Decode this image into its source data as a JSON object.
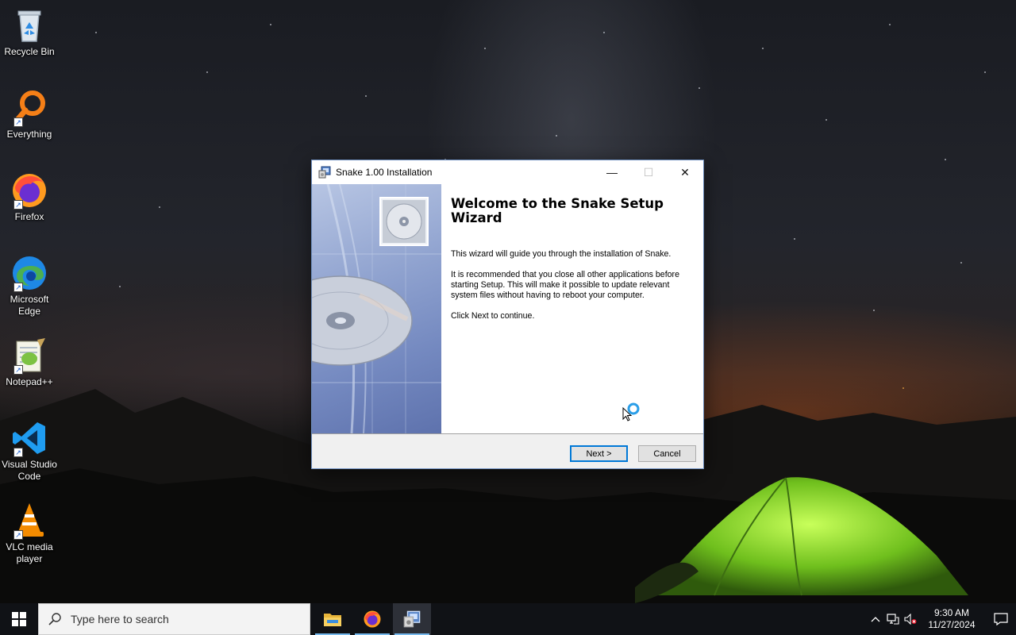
{
  "desktop": {
    "icons": [
      {
        "label": "Recycle Bin",
        "icon": "recycle-bin-icon"
      },
      {
        "label": "Everything",
        "icon": "everything-search-icon"
      },
      {
        "label": "Firefox",
        "icon": "firefox-icon"
      },
      {
        "label": "Microsoft Edge",
        "icon": "edge-icon"
      },
      {
        "label": "Notepad++",
        "icon": "notepadpp-icon"
      },
      {
        "label": "Visual Studio Code",
        "icon": "vscode-icon"
      },
      {
        "label": "VLC media player",
        "icon": "vlc-icon"
      }
    ]
  },
  "dialog": {
    "title": "Snake 1.00 Installation",
    "controls": {
      "minimize": "—",
      "maximize": "☐",
      "close": "✕"
    },
    "heading": "Welcome to the Snake Setup Wizard",
    "paragraphs": [
      "This wizard will guide you through the installation of Snake.",
      "It is recommended that you close all other applications before starting Setup. This will make it possible to update relevant system files without having to reboot your computer.",
      "Click Next to continue."
    ],
    "next_label": "Next >",
    "cancel_label": "Cancel"
  },
  "taskbar": {
    "search_placeholder": "Type here to search",
    "apps": [
      "file-explorer-icon",
      "firefox-icon",
      "installer-icon"
    ],
    "clock_time": "9:30 AM",
    "clock_date": "11/27/2024"
  },
  "colors": {
    "accent": "#0078d7",
    "taskbar": "#101216",
    "dialog_border": "#6e8fbf"
  }
}
